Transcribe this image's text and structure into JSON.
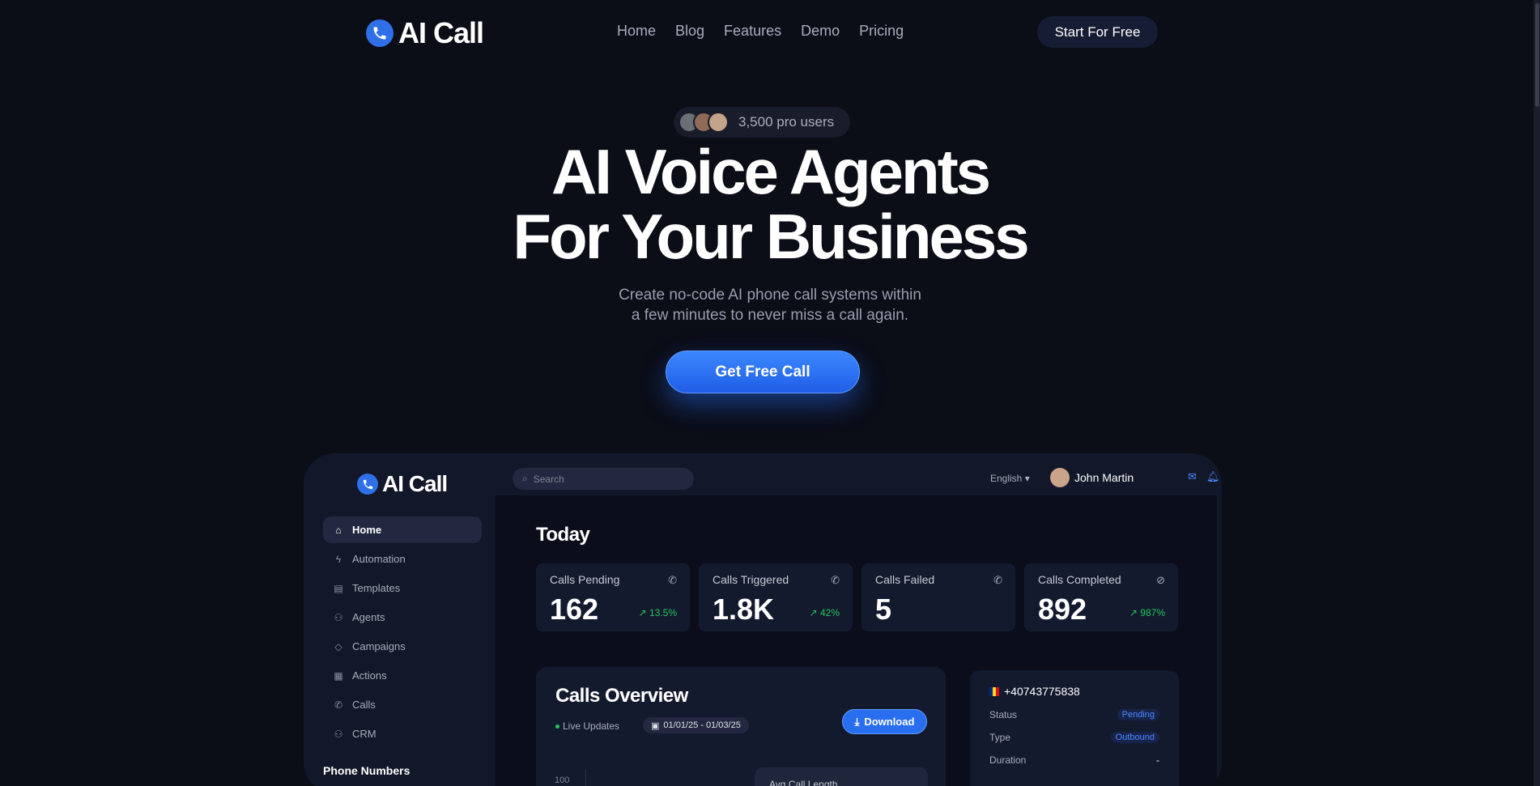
{
  "nav": {
    "logo": "AI Call",
    "links": [
      "Home",
      "Blog",
      "Features",
      "Demo",
      "Pricing"
    ],
    "cta": "Start For Free"
  },
  "hero": {
    "users": "3,500 pro users",
    "title_line1": "AI Voice Agents",
    "title_line2": "For Your Business",
    "sub_line1": "Create no-code AI phone call systems within",
    "sub_line2": "a few minutes to never miss a call again.",
    "cta": "Get Free Call"
  },
  "dashboard": {
    "logo": "AI Call",
    "search_placeholder": "Search",
    "language": "English",
    "user_name": "John Martin",
    "sidebar": {
      "items": [
        "Home",
        "Automation",
        "Templates",
        "Agents",
        "Campaigns",
        "Actions",
        "Calls",
        "CRM"
      ],
      "section": "Phone Numbers"
    },
    "today": "Today",
    "stats": [
      {
        "label": "Calls Pending",
        "value": "162",
        "change": "13.5%"
      },
      {
        "label": "Calls Triggered",
        "value": "1.8K",
        "change": "42%"
      },
      {
        "label": "Calls Failed",
        "value": "5",
        "change": ""
      },
      {
        "label": "Calls Completed",
        "value": "892",
        "change": "987%"
      }
    ],
    "overview": {
      "title": "Calls Overview",
      "live": "Live Updates",
      "date_range": "01/01/25 - 01/03/25",
      "download": "Download",
      "axis_top": "100",
      "avg_label": "Avg Call Length"
    },
    "detail": {
      "phone": "+40743775838",
      "status_label": "Status",
      "status_value": "Pending",
      "type_label": "Type",
      "type_value": "Outbound",
      "duration_label": "Duration",
      "duration_value": "-"
    }
  }
}
